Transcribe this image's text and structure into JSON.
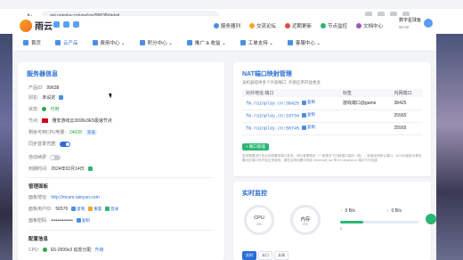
{
  "browser": {
    "url": "api.rainplay.cn/vps/rgs/99638/detail"
  },
  "site": {
    "logo_text": "雨云",
    "top_nav": [
      {
        "label": "服务器列",
        "color": "#4a90e2"
      },
      {
        "label": "交流论坛",
        "color": "#f5a623"
      },
      {
        "label": "近期更新",
        "color": "#e74c3c"
      },
      {
        "label": "节点监控",
        "color": "#2bb673"
      },
      {
        "label": "文档中心",
        "color": "#9b59b6"
      }
    ],
    "user_name": "数字星球鱼",
    "user_sub": "¥0.00"
  },
  "sub_nav": [
    {
      "label": "首页"
    },
    {
      "label": "云产品"
    },
    {
      "label": "费用中心 ⌄"
    },
    {
      "label": "积分中心 ⌄"
    },
    {
      "label": "推广 & 收益 ⌄"
    },
    {
      "label": "工单支持 ⌄"
    },
    {
      "label": "客服中心 ⌄"
    }
  ],
  "server_info": {
    "title": "服务器信息",
    "product_id_label": "产品ID:",
    "product_id": "99638",
    "alias_label": "别名:",
    "alias": "未设定",
    "status_label": "状态:",
    "status": "可用",
    "node_label": "节点:",
    "node": "雅安游戏云2699v3E5极速节点",
    "traffic_label": "剩余可用CPU电量:",
    "traffic": "24028",
    "traffic_tag": "充值",
    "auto_renew_label": "同步登录凭据:",
    "auto_renew_on": true,
    "expire_label": "到期时间:",
    "expire": "2024年02月14日",
    "backup_label": "自动续费",
    "manage_title": "管理面板",
    "panel_label": "面板地址:",
    "panel_url": "http://mcsm.rainyun.com",
    "panel_id_label": "面板用户ID:",
    "panel_id": "56570",
    "panel_copy": "复制",
    "panel_reset": "重置",
    "panel_login": "登录",
    "panel_pwd_label": "面板密码:",
    "panel_pwd": "••••••••••••••",
    "panel_pwd_copy": "复制",
    "config_title": "配置信息",
    "cpu_label": "CPU:",
    "cpu": "E5-2699v3 动态分配",
    "cpu_tag": "升级"
  },
  "nat": {
    "title": "NAT端口映射管理",
    "desc": "该机器提供多个外部端口, 外部应用开放更多",
    "col_addr": "对外地址:端口",
    "col_label": "标签",
    "col_port": "内网端口",
    "rows": [
      {
        "addr": "fm.rainplay.cn:38425",
        "copy": "复制",
        "label": "游戏端口@game",
        "port": "38425"
      },
      {
        "addr": "fm.rainplay.cn:18734",
        "copy": "复制",
        "label": "",
        "port": "25565"
      },
      {
        "addr": "fm.rainplay.cn:56745",
        "copy": "复制",
        "label": "",
        "port": "25565"
      }
    ],
    "add_btn": "+ 端口管理",
    "note": "若您需要进行多实例部署或端口更改，请与客服联系（一般情况下内网端口保持一致），若使用非默认端口，MCSM面板中需设置对应端口号才能正常使用；请在实例设置中绑定 minecraft_tcp 或 fm.rainplay.cn 端口方可连接"
  },
  "monitor": {
    "title": "实时监控",
    "cpu_label": "CPU",
    "cpu_val": "0%",
    "mem_label": "内存",
    "mem_val": "0%",
    "net_in": "0 B/s",
    "net_out": "0 B/s",
    "net_bar_label": "0",
    "net_bar_max": "",
    "net_fill": 0.3,
    "ranges": [
      "实时",
      "本日",
      "本周"
    ]
  },
  "colors": {
    "accent": "#2b6fd6",
    "green": "#2bb673"
  }
}
